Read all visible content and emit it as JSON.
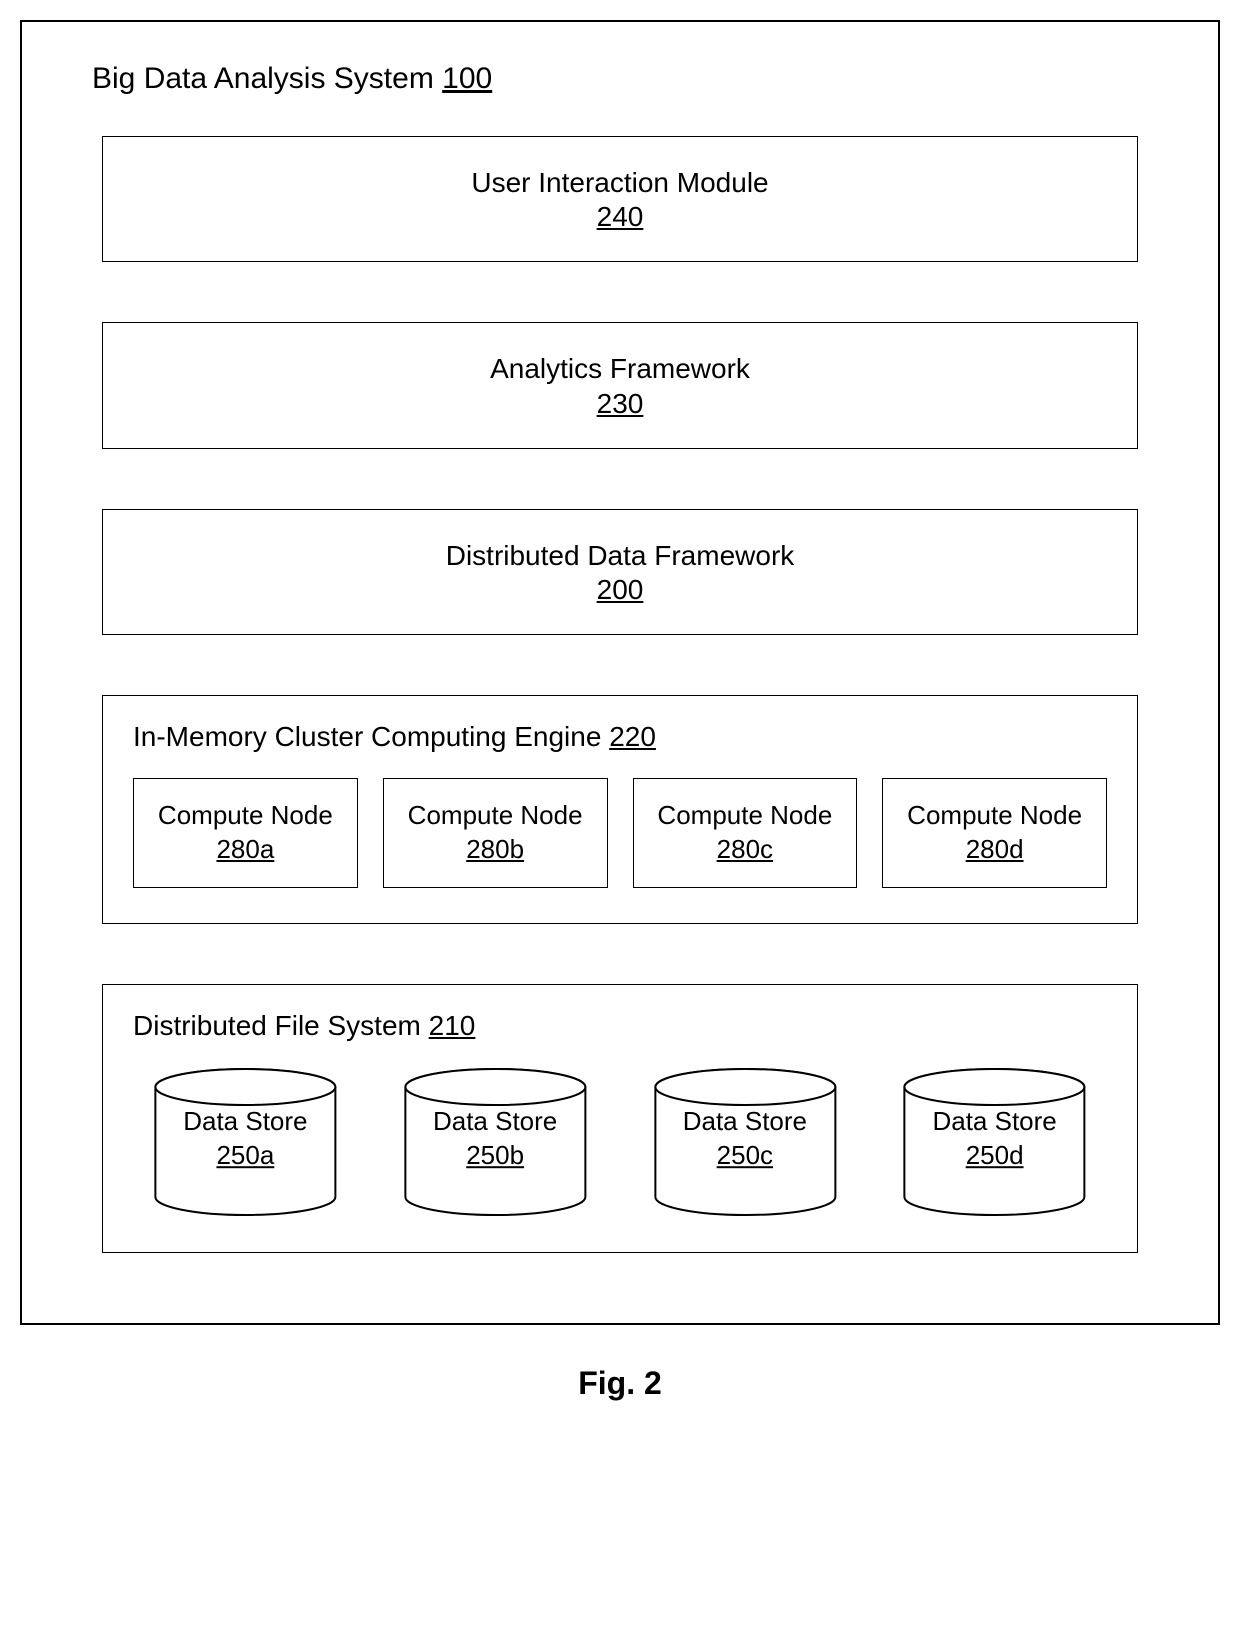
{
  "system": {
    "title": "Big Data Analysis System",
    "ref": "100"
  },
  "layers": [
    {
      "label": "User Interaction Module",
      "ref": "240"
    },
    {
      "label": "Analytics Framework",
      "ref": "230"
    },
    {
      "label": "Distributed Data Framework",
      "ref": "200"
    }
  ],
  "cluster": {
    "title": "In-Memory Cluster Computing Engine",
    "ref": "220",
    "nodes": [
      {
        "label": "Compute Node",
        "ref": "280a"
      },
      {
        "label": "Compute Node",
        "ref": "280b"
      },
      {
        "label": "Compute Node",
        "ref": "280c"
      },
      {
        "label": "Compute Node",
        "ref": "280d"
      }
    ]
  },
  "filesystem": {
    "title": "Distributed File System",
    "ref": "210",
    "stores": [
      {
        "label": "Data Store",
        "ref": "250a"
      },
      {
        "label": "Data Store",
        "ref": "250b"
      },
      {
        "label": "Data Store",
        "ref": "250c"
      },
      {
        "label": "Data Store",
        "ref": "250d"
      }
    ]
  },
  "caption": "Fig. 2"
}
